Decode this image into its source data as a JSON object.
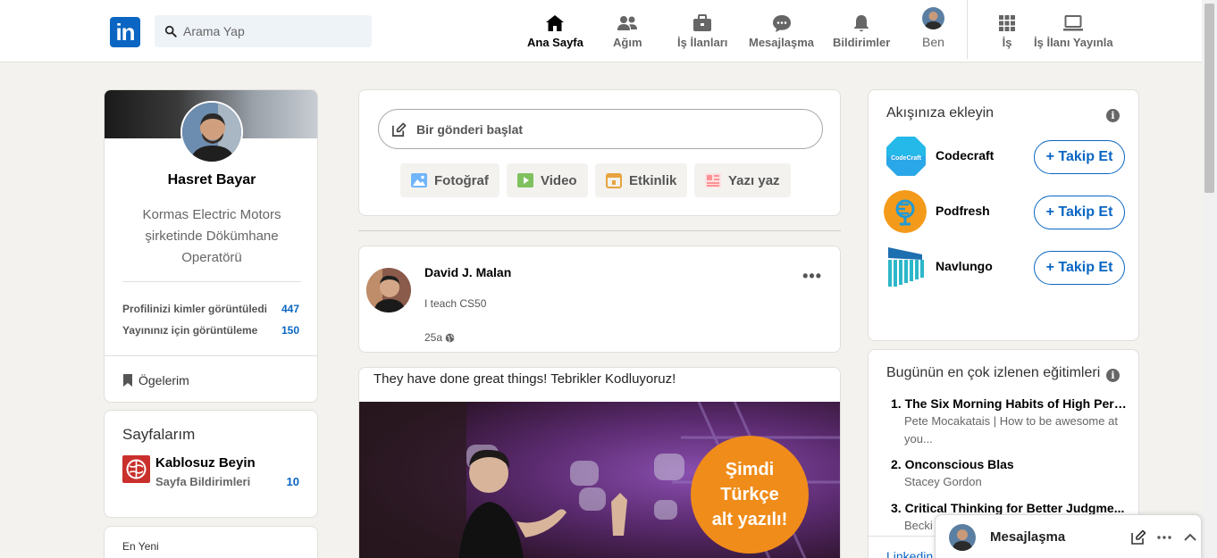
{
  "nav": {
    "logo_text": "in",
    "search_placeholder": "Arama Yap",
    "items": [
      {
        "label": "Ana Sayfa",
        "icon": "home-icon"
      },
      {
        "label": "Ağım",
        "icon": "network-icon"
      },
      {
        "label": "İş İlanları",
        "icon": "briefcase-icon"
      },
      {
        "label": "Mesajlaşma",
        "icon": "chat-icon"
      },
      {
        "label": "Bildirimler",
        "icon": "bell-icon"
      },
      {
        "label": "Ben",
        "icon": "avatar"
      },
      {
        "label": "İş",
        "icon": "grid-icon"
      },
      {
        "label": "İş İlanı Yayınla",
        "icon": "laptop-icon"
      }
    ]
  },
  "profile": {
    "name": "Hasret Bayar",
    "headline": "Kormas Electric Motors şirketinde Dökümhane Operatörü",
    "stats": [
      {
        "label": "Profilinizi kimler görüntüledi",
        "value": "447"
      },
      {
        "label": "Yayınınız için görüntüleme",
        "value": "150"
      }
    ],
    "items_label": "Ögelerim"
  },
  "pages": {
    "title": "Sayfalarım",
    "page_name": "Kablosuz Beyin",
    "page_sub": "Sayfa Bildirimleri",
    "page_count": "10"
  },
  "recent": {
    "title": "En Yeni"
  },
  "compose": {
    "placeholder": "Bir gönderi başlat",
    "buttons": [
      {
        "label": "Fotoğraf",
        "icon": "photo-icon",
        "color": "#70b5f9"
      },
      {
        "label": "Video",
        "icon": "video-icon",
        "color": "#7fc15e"
      },
      {
        "label": "Etkinlik",
        "icon": "calendar-icon",
        "color": "#e7a33e"
      },
      {
        "label": "Yazı yaz",
        "icon": "article-icon",
        "color": "#fc9295"
      }
    ]
  },
  "post": {
    "author": "David J. Malan",
    "subtitle": "I teach CS50",
    "time": "25a",
    "menu": "•••"
  },
  "post2": {
    "text": "They have done great things! Tebrikler Kodluyoruz!",
    "badge_line1": "Şimdi",
    "badge_line2": "Türkçe",
    "badge_line3": "alt yazılı!"
  },
  "suggestions": {
    "title": "Akışınıza ekleyin",
    "follow_label": "+ Takip Et",
    "items": [
      {
        "name": "Codecraft",
        "logo_text": "CodeCraft"
      },
      {
        "name": "Podfresh"
      },
      {
        "name": "Navlungo"
      }
    ]
  },
  "courses": {
    "title": "Bugünün en çok izlenen eğitimleri",
    "items": [
      {
        "title": "1. The Six Morning Habits of High Perf...",
        "sub": "Pete Mocakatais | How to be awesome at you..."
      },
      {
        "title": "2. Onconscious Blas",
        "sub": "Stacey Gordon"
      },
      {
        "title": "3. Critical Thinking for Better Judgme...",
        "sub": "Becki"
      }
    ],
    "link": "Linkedin"
  },
  "messaging": {
    "title": "Mesajlaşma"
  },
  "colors": {
    "brand": "#0a66c2",
    "background": "#f3f2ef",
    "badge_orange": "#f08c1a"
  }
}
